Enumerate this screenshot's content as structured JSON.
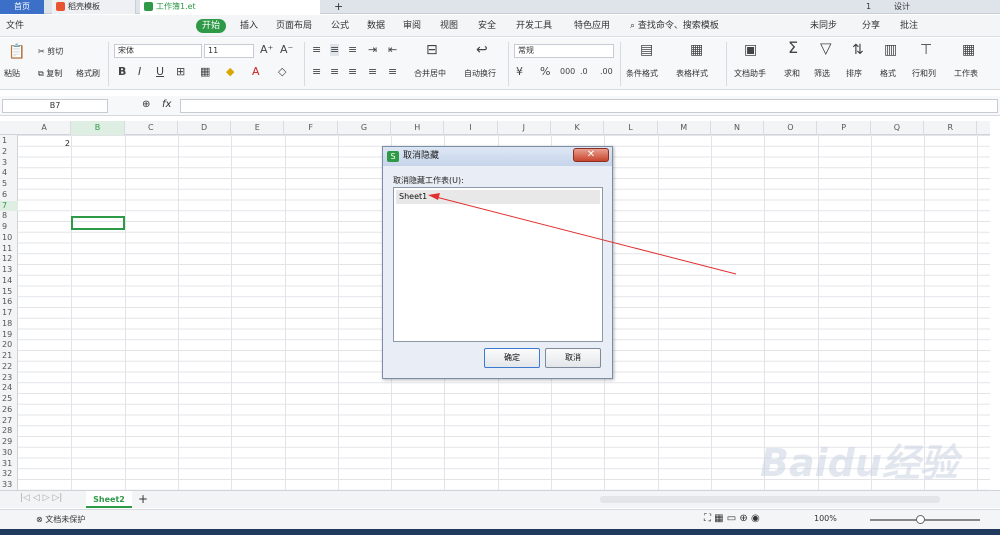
{
  "tabs": {
    "home": "首页",
    "template": "稻壳模板",
    "file": "工作簿1.et",
    "new_tab": "+"
  },
  "window": {
    "user_badge": "1",
    "settings": "设计"
  },
  "menu": {
    "file": "文件",
    "items": [
      "开始",
      "插入",
      "页面布局",
      "公式",
      "数据",
      "审阅",
      "视图",
      "安全",
      "开发工具",
      "特色应用"
    ],
    "search": "查找命令、搜索模板",
    "sync": "未同步",
    "share": "分享",
    "comment": "批注"
  },
  "ribbon": {
    "paste": "粘贴",
    "cut": "剪切",
    "copy": "复制",
    "format_painter": "格式刷",
    "font_name": "宋体",
    "font_size": "11",
    "merge_center": "合并居中",
    "wrap_text": "自动换行",
    "number_format": "常规",
    "conditional_format": "条件格式",
    "table_style": "表格样式",
    "doc_helper": "文档助手",
    "sum": "求和",
    "filter": "筛选",
    "sort": "排序",
    "format": "格式",
    "row_col": "行和列",
    "worksheet": "工作表"
  },
  "formula_bar": {
    "cell_ref": "B7",
    "fx": "fx",
    "content": ""
  },
  "grid": {
    "columns": [
      "A",
      "B",
      "C",
      "D",
      "E",
      "F",
      "G",
      "H",
      "I",
      "J",
      "K",
      "L",
      "M",
      "N",
      "O",
      "P",
      "Q",
      "R"
    ],
    "rows": [
      "1",
      "2",
      "3",
      "4",
      "5",
      "6",
      "7",
      "8",
      "9",
      "10",
      "11",
      "12",
      "13",
      "14",
      "15",
      "16",
      "17",
      "18",
      "19",
      "20",
      "21",
      "22",
      "23",
      "24",
      "25",
      "26",
      "27",
      "28",
      "29",
      "30",
      "31",
      "32",
      "33"
    ],
    "a1_value": "2",
    "selected_cell": "B7"
  },
  "dialog": {
    "title": "取消隐藏",
    "label": "取消隐藏工作表(U):",
    "list_items": [
      "Sheet1"
    ],
    "ok": "确定",
    "cancel": "取消",
    "close": "✕"
  },
  "sheets": {
    "active": "Sheet2",
    "add": "+"
  },
  "status": {
    "protection": "文档未保护",
    "zoom": "100%"
  },
  "watermark": "Baidu经验",
  "colors": {
    "accent_green": "#2e9a47",
    "tab_blue": "#3b6fc8",
    "arrow_red": "#e03030"
  }
}
